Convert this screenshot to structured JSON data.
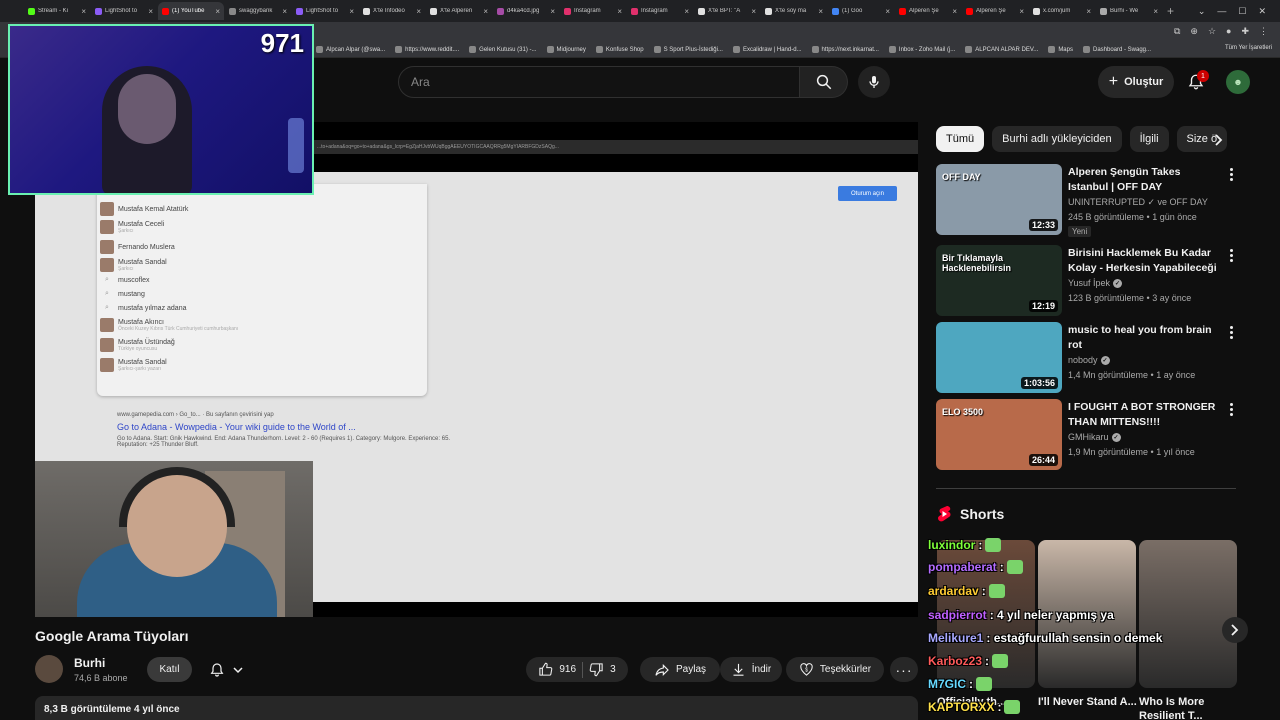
{
  "browser": {
    "tabs": [
      {
        "title": "Stream - Ki",
        "color": "#53fc18"
      },
      {
        "title": "LightShot to",
        "color": "#8b5cf6"
      },
      {
        "title": "(1) YouTube",
        "color": "#ff0000"
      },
      {
        "title": "swaggybank",
        "color": "#888888"
      },
      {
        "title": "LightShot to",
        "color": "#8b5cf6"
      },
      {
        "title": "X'te Infodeo",
        "color": "#e0e0e0"
      },
      {
        "title": "X'te Alperen",
        "color": "#e0e0e0"
      },
      {
        "title": "d4ka4cd.jpg",
        "color": "#a64ca6"
      },
      {
        "title": "Instagram",
        "color": "#e1306c"
      },
      {
        "title": "Instagram",
        "color": "#e1306c"
      },
      {
        "title": "X'te BPT: \"A",
        "color": "#e0e0e0"
      },
      {
        "title": "X'te soy ma",
        "color": "#e0e0e0"
      },
      {
        "title": "(1) Goo",
        "color": "#4285f4"
      },
      {
        "title": "Alperen Şe",
        "color": "#ff0000"
      },
      {
        "title": "Alperen Şe",
        "color": "#ff0000"
      },
      {
        "title": "x.com/jum",
        "color": "#e0e0e0"
      },
      {
        "title": "Burhi - We",
        "color": "#aaaaaa"
      }
    ],
    "bookmarks": [
      "Alpcan Alpar (@swa...",
      "https://www.reddit....",
      "Gelen Kutusu (31) -...",
      "Midjourney",
      "Konfuse Shop",
      "S Sport Plus-İstediği...",
      "Excalidraw | Hand-d...",
      "https://next.inkarnat...",
      "Inbox - Zoho Mail (j...",
      "ALPCAN ALPAR DEV...",
      "Maps",
      "Dashboard - Swagg..."
    ],
    "all_bookmarks": "Tüm Yer İşaretleri"
  },
  "youtube": {
    "search_placeholder": "Ara",
    "create_label": "Oluştur",
    "notif_count": "1"
  },
  "player": {
    "stream_counter": "971",
    "ss_url": "...to+adana&oq=go+to+adana&gs_lcrp=EgZjaHJvbWUqBggAEEUYOTIGCAAQRRg5MgYIARBFGDzSAQg...",
    "ss_top_button": "Oturum açın",
    "suggestions": [
      {
        "text": "Mustafa Kemal Atatürk",
        "sub": "",
        "thumb": true
      },
      {
        "text": "Mustafa Ceceli",
        "sub": "Şarkıcı",
        "thumb": true
      },
      {
        "text": "Fernando Muslera",
        "sub": "",
        "thumb": true
      },
      {
        "text": "Mustafa Sandal",
        "sub": "Şarkıcı",
        "thumb": true
      },
      {
        "text": "muscoflex",
        "sub": "",
        "thumb": false
      },
      {
        "text": "mustang",
        "sub": "",
        "thumb": false
      },
      {
        "text": "mustafa yılmaz adana",
        "sub": "",
        "thumb": false
      },
      {
        "text": "Mustafa Akıncı",
        "sub": "Önceki Kuzey Kıbrıs Türk Cumhuriyeti cumhurbaşkanı",
        "thumb": true
      },
      {
        "text": "Mustafa Üstündağ",
        "sub": "Türkiye oyuncusu",
        "thumb": true
      },
      {
        "text": "Mustafa Sandal",
        "sub": "Şarkıcı-şarkı yazarı",
        "thumb": true
      }
    ],
    "result_domain": "www.gamepedia.com › Go_to... · Bu sayfanın çevirisini yap",
    "result_link": "Go to Adana - Wowpedia - Your wiki guide to the World of ...",
    "result_desc": "Go to Adana. Start: Gnik Hawkwind. End: Adana Thunderhorn. Level: 2 - 60 (Requires 1). Category: Mulgore. Experience: 65. Reputation: +25 Thunder Bluff."
  },
  "video": {
    "title": "Google Arama Tüyoları",
    "channel": "Burhi",
    "subscribers": "74,6 B abone",
    "join_label": "Katıl",
    "likes": "916",
    "dislikes": "3",
    "share_label": "Paylaş",
    "download_label": "İndir",
    "thanks_label": "Teşekkürler",
    "views_line": "8,3 B görüntüleme  4 yıl önce"
  },
  "chips": [
    "Tümü",
    "Burhi adlı yükleyiciden",
    "İlgili",
    "Size ö"
  ],
  "recommended": [
    {
      "title": "Alperen Şengün Takes Istanbul | OFF DAY",
      "channel": "UNINTERRUPTED ✓ ve OFF DAY",
      "verified": false,
      "meta": "245 B görüntüleme • 1 gün önce",
      "duration": "12:33",
      "badge": "Yeni",
      "thumb_bg": "#8a9aa8",
      "thumb_text": "OFF DAY"
    },
    {
      "title": "Birisini Hacklemek Bu Kadar Kolay - Herkesin Yapabileceği ...",
      "channel": "Yusuf İpek",
      "verified": true,
      "meta": "123 B görüntüleme • 3 ay önce",
      "duration": "12:19",
      "badge": "",
      "thumb_bg": "#1d2a22",
      "thumb_text": "Bir Tıklamayla Hacklenebilirsin"
    },
    {
      "title": "music to heal you from brain rot",
      "channel": "nobody",
      "verified": true,
      "meta": "1,4 Mn görüntüleme • 1 ay önce",
      "duration": "1:03:56",
      "badge": "",
      "thumb_bg": "#4ea7c0",
      "thumb_text": ""
    },
    {
      "title": "I FOUGHT A BOT STRONGER THAN MITTENS!!!!",
      "channel": "GMHikaru",
      "verified": true,
      "meta": "1,9 Mn görüntüleme • 1 yıl önce",
      "duration": "26:44",
      "badge": "",
      "thumb_bg": "#b86a4a",
      "thumb_text": "ELO 3500"
    }
  ],
  "shorts": {
    "heading": "Shorts",
    "items": [
      {
        "title": "Officially th...",
        "bg": "#6b4a3a"
      },
      {
        "title": "I'll Never Stand A...",
        "bg": "#c9b7a8"
      },
      {
        "title": "Who Is More Resilient T...",
        "bg": "#7a6e66"
      }
    ]
  },
  "chat": [
    {
      "user": "luxindor",
      "text": "",
      "color": "#7fff3a"
    },
    {
      "user": "pompaberat",
      "text": "",
      "color": "#b46cff"
    },
    {
      "user": "ardardav",
      "text": "",
      "color": "#ffcc33"
    },
    {
      "user": "sadpierrot",
      "text": ": 4 yıl neler yapmış ya",
      "color": "#c060ff"
    },
    {
      "user": "Melikure1",
      "text": ": estağfurullah sensin o demek",
      "color": "#a8a8ff"
    },
    {
      "user": "Karboz23",
      "text": "",
      "color": "#ff5a5a"
    },
    {
      "user": "M7GIC",
      "text": "",
      "color": "#66d9ff"
    },
    {
      "user": "KAPTORXX",
      "text": "",
      "color": "#ffe14a"
    }
  ]
}
